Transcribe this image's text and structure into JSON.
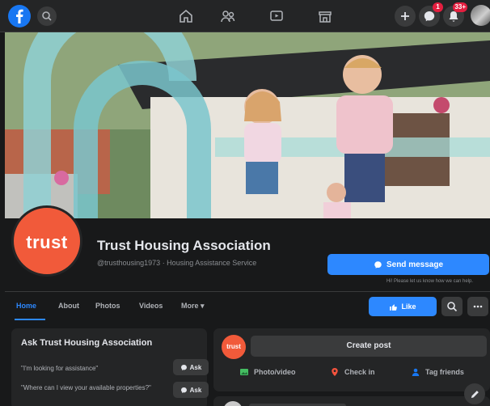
{
  "topbar": {
    "notification_badges": {
      "messenger": "1",
      "notifications": "33+"
    }
  },
  "page": {
    "name": "Trust Housing Association",
    "subtitle": "@trusthousing1973 · Housing Assistance Service",
    "logo_text": "trust",
    "send_message_label": "Send message",
    "send_message_note": "Hi! Please let us know how we can help."
  },
  "tabs": {
    "items": [
      {
        "label": "Home",
        "active": true
      },
      {
        "label": "About"
      },
      {
        "label": "Photos"
      },
      {
        "label": "Videos"
      },
      {
        "label": "More ▾"
      }
    ],
    "like_label": "Like"
  },
  "ask_card": {
    "title": "Ask Trust Housing Association",
    "questions": [
      {
        "text": "\"I'm looking for assistance\"",
        "button": "Ask"
      },
      {
        "text": "\"Where can I view your available properties?\"",
        "button": "Ask"
      }
    ]
  },
  "composer": {
    "avatar_text": "trust",
    "create_post_label": "Create post",
    "actions": [
      {
        "label": "Photo/video",
        "icon": "photo-icon",
        "color": "#45bd62"
      },
      {
        "label": "Check in",
        "icon": "location-pin-icon",
        "color": "#f5533d"
      },
      {
        "label": "Tag friends",
        "icon": "tag-friends-icon",
        "color": "#1877f2"
      }
    ]
  },
  "colors": {
    "brand_orange": "#f15a3a",
    "accent_blue": "#2d88ff",
    "panel": "#242526",
    "background": "#18191a"
  }
}
